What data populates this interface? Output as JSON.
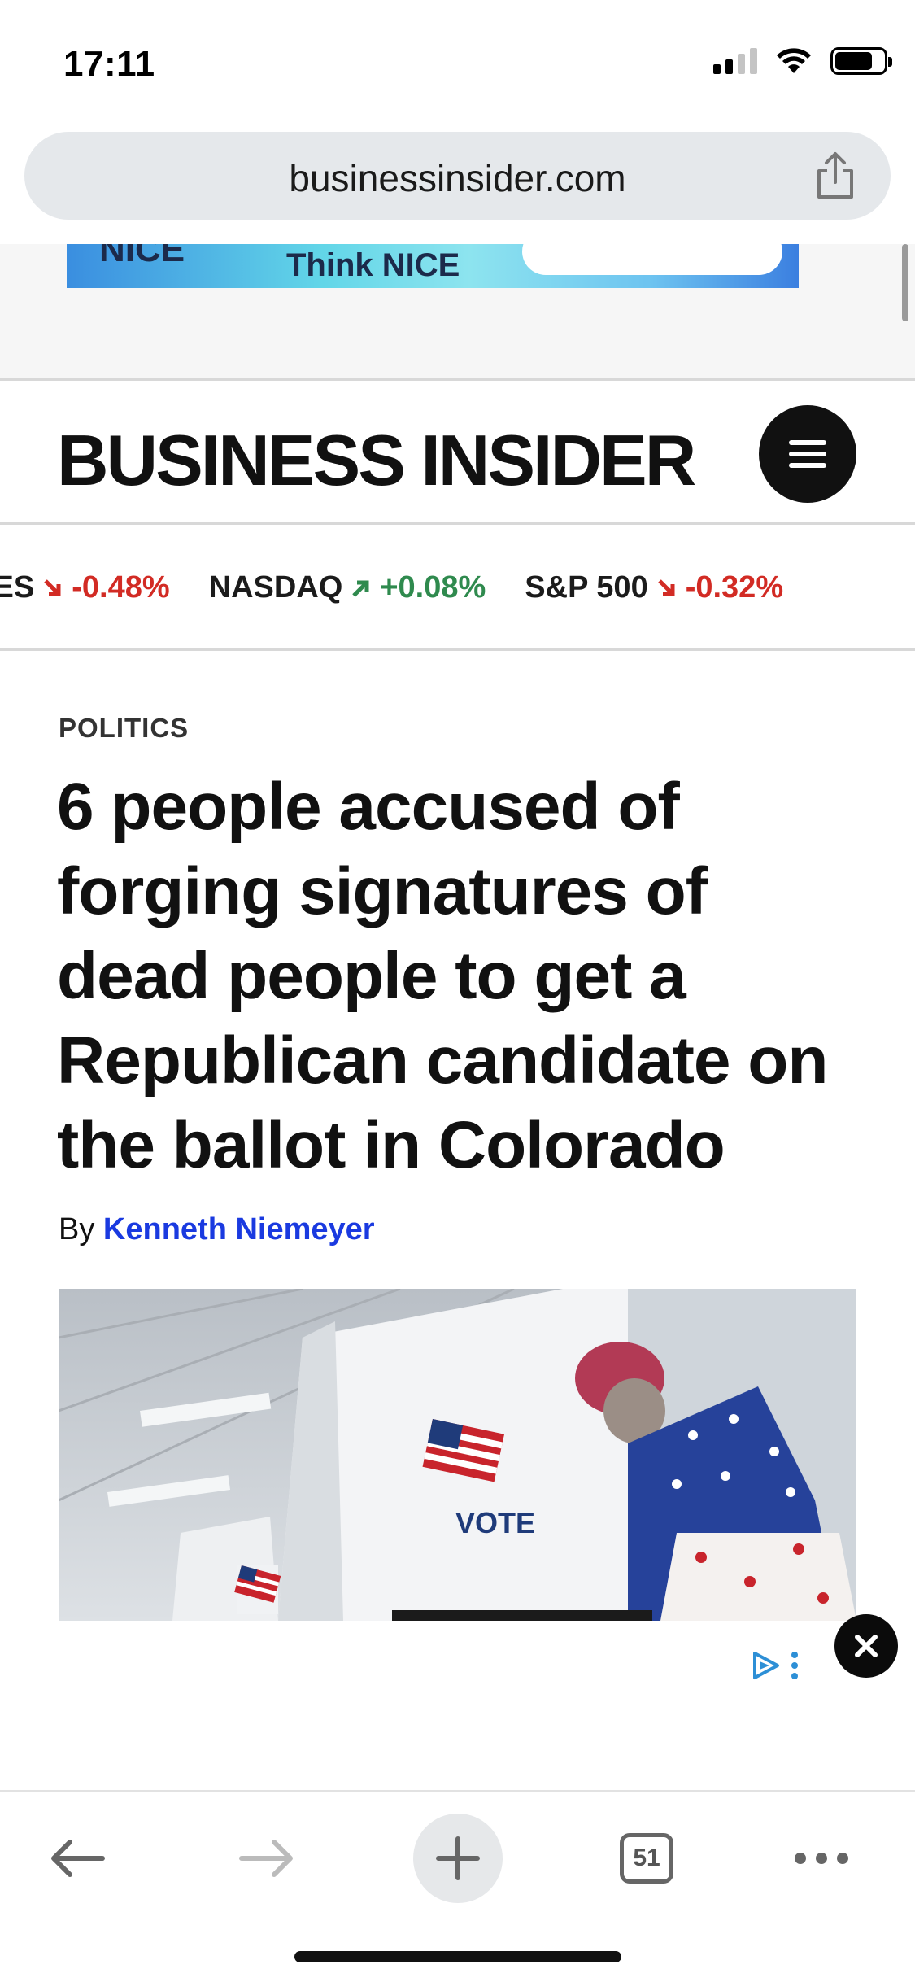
{
  "status_bar": {
    "time": "17:11"
  },
  "browser": {
    "url": "businessinsider.com",
    "tab_count": "51"
  },
  "ad_top": {
    "text": "Think NICE",
    "logo": "NICE"
  },
  "header": {
    "logo": "BUSINESS INSIDER"
  },
  "ticker": [
    {
      "name": "DOW JONES",
      "value": "-0.48%",
      "direction": "down"
    },
    {
      "name": "NASDAQ",
      "value": "+0.08%",
      "direction": "up"
    },
    {
      "name": "S&P 500",
      "value": "-0.32%",
      "direction": "down"
    }
  ],
  "article": {
    "category": "POLITICS",
    "headline": "6 people accused of forging signatures of dead people to get a Republican candidate on the ballot in Colorado",
    "by_prefix": "By",
    "author": "Kenneth Niemeyer",
    "photo_vote_text": "VOTE"
  },
  "colors": {
    "accent_link": "#1a3ae0",
    "down": "#d22b24",
    "up": "#2f8a4e"
  }
}
